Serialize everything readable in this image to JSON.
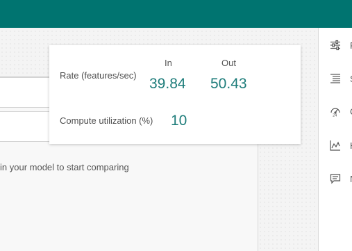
{
  "colors": {
    "topbar": "#007470",
    "value_text": "#1d7c7a"
  },
  "stats": {
    "rate_label": "Rate (features/sec)",
    "in_header": "In",
    "out_header": "Out",
    "rate_in": "39.84",
    "rate_out": "50.43",
    "compute_label": "Compute utilization (%)",
    "compute_value": "10"
  },
  "model_panel": {
    "hint": "in your model to start comparing"
  },
  "sidebar": {
    "items": [
      {
        "icon": "sliders-icon",
        "label": "F"
      },
      {
        "icon": "list-icon",
        "label": "S"
      },
      {
        "icon": "gauge-icon",
        "label": "C"
      },
      {
        "icon": "line-chart-icon",
        "label": "H"
      },
      {
        "icon": "message-icon",
        "label": "N"
      }
    ]
  }
}
